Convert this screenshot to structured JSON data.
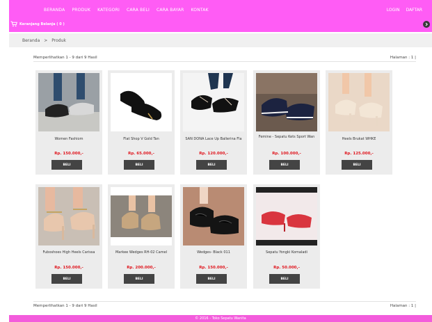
{
  "nav": {
    "items": [
      "BERANDA",
      "PRODUK",
      "KATEGORI",
      "CARA BELI",
      "CARA BAYAR",
      "KONTAK"
    ],
    "login": "LOGIN",
    "daftar": "DAFTAR"
  },
  "cart": {
    "label": "Keranjang Belanja ( 0 )",
    "icon": "cart-icon"
  },
  "breadcrumb": {
    "home": "Beranda",
    "sep": ">",
    "current": "Produk"
  },
  "info": {
    "showing": "Memperlihatkan 1 - 9 dari 9 Hasil",
    "page": "Halaman : 1 |"
  },
  "products": [
    {
      "name": "Women Fashiom",
      "price": "Rp. 150.000,-",
      "buy": "BELI"
    },
    {
      "name": "Flat Shop V Gold Tan",
      "price": "Rp. 65.000,-",
      "buy": "BELI"
    },
    {
      "name": "SAN DONA Lace Up Ballerina Fla",
      "price": "Rp. 120.000,-",
      "buy": "BELI"
    },
    {
      "name": "Femine - Sepatu Kets Sport Wan",
      "price": "Rp. 100.000,-",
      "buy": "BELI"
    },
    {
      "name": "Heels Brukat WHKE",
      "price": "Rp. 125.000,-",
      "buy": "BELI"
    },
    {
      "name": "Fuboshoes High Heels Carissa",
      "price": "Rp. 150.000,-",
      "buy": "BELI"
    },
    {
      "name": "Markee Wedges RH-02 Camel",
      "price": "Rp. 200.000,-",
      "buy": "BELI"
    },
    {
      "name": "Wedges- Black 011",
      "price": "Rp. 150.000,-",
      "buy": "BELI"
    },
    {
      "name": "Sepatu Yongki Komaladi",
      "price": "Rp. 50.000,-",
      "buy": "BELI"
    }
  ],
  "footer": {
    "text": "© 2016 - Toko Sepatu Wanita"
  },
  "colors": {
    "header": "#ff5cf5",
    "footer": "#f35cdc",
    "price": "#e0161e",
    "button": "#444444"
  }
}
